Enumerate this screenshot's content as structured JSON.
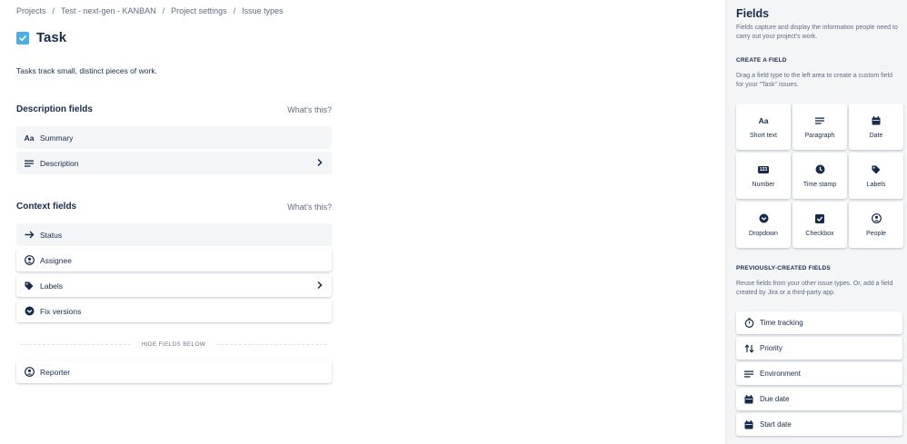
{
  "breadcrumb": [
    "Projects",
    "Test - next-gen - KANBAN",
    "Project settings",
    "Issue types"
  ],
  "breadcrumb_sep": "/",
  "page": {
    "title": "Task",
    "description": "Tasks track small, distinct pieces of work."
  },
  "description_fields": {
    "title": "Description fields",
    "whats_this": "What's this?",
    "items": [
      {
        "label": "Summary",
        "icon": "text-icon"
      },
      {
        "label": "Description",
        "icon": "paragraph-icon"
      }
    ]
  },
  "context_fields": {
    "title": "Context fields",
    "whats_this": "What's this?",
    "items": [
      {
        "label": "Status",
        "icon": "arrow-right-icon"
      },
      {
        "label": "Assignee",
        "icon": "person-icon"
      },
      {
        "label": "Labels",
        "icon": "tag-icon"
      },
      {
        "label": "Fix versions",
        "icon": "chevron-circle-icon"
      }
    ],
    "hide_label": "HIDE FIELDS BELOW",
    "hidden_items": [
      {
        "label": "Reporter",
        "icon": "person-icon"
      }
    ]
  },
  "panel": {
    "title": "Fields",
    "subtitle": "Fields capture and display the information people need to carry out your project's work.",
    "create_heading": "CREATE A FIELD",
    "create_text": "Drag a field type to the left area to create a custom field for your \"Task\" issues.",
    "tiles": [
      {
        "label": "Short text",
        "icon": "short-text-icon",
        "glyph": "Aa"
      },
      {
        "label": "Paragraph",
        "icon": "paragraph-icon"
      },
      {
        "label": "Date",
        "icon": "calendar-icon"
      },
      {
        "label": "Number",
        "icon": "number-icon",
        "glyph": "123"
      },
      {
        "label": "Time stamp",
        "icon": "clock-icon"
      },
      {
        "label": "Labels",
        "icon": "tag-icon"
      },
      {
        "label": "Dropdown",
        "icon": "dropdown-icon"
      },
      {
        "label": "Checkbox",
        "icon": "checkbox-icon"
      },
      {
        "label": "People",
        "icon": "person-icon"
      }
    ],
    "previous_heading": "PREVIOUSLY-CREATED FIELDS",
    "previous_text": "Reuse fields from your other issue types. Or, add a field created by Jira or a third-party app.",
    "previous": [
      {
        "label": "Time tracking",
        "icon": "stopwatch-icon"
      },
      {
        "label": "Priority",
        "icon": "priority-icon"
      },
      {
        "label": "Environment",
        "icon": "paragraph-icon"
      },
      {
        "label": "Due date",
        "icon": "calendar-icon"
      },
      {
        "label": "Start date",
        "icon": "calendar-icon"
      }
    ]
  },
  "colors": {
    "task_icon": "#4bade8",
    "text": "#172b4d",
    "muted": "#5e6c84",
    "panel_bg": "#f4f5f7"
  }
}
